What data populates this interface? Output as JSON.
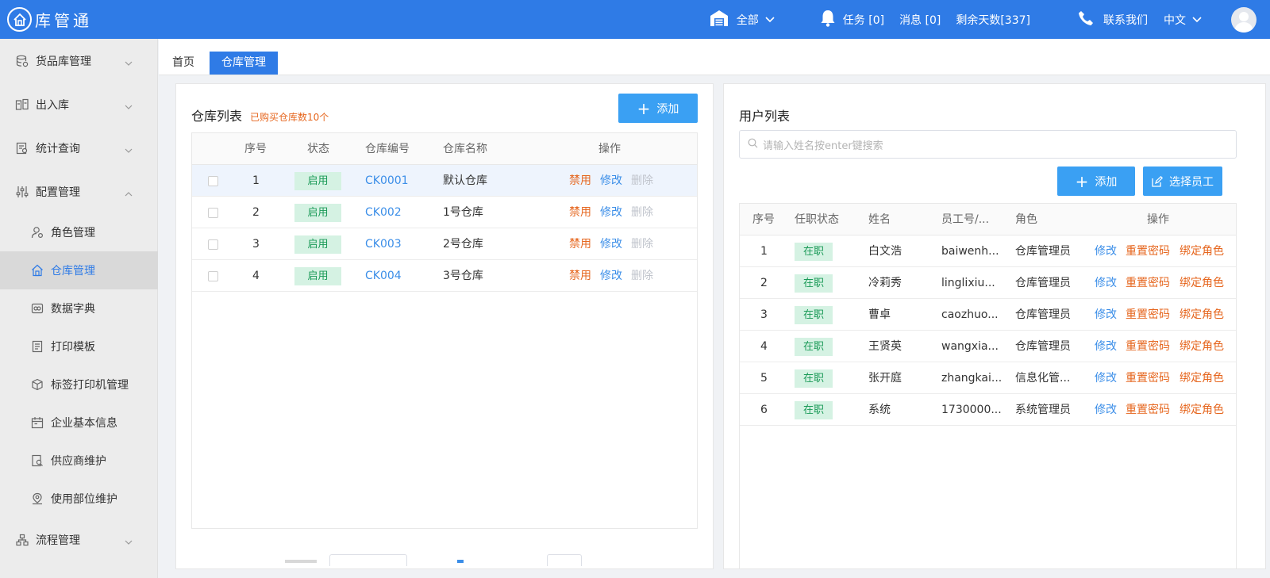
{
  "app": {
    "title": "库管通"
  },
  "topbar": {
    "warehouse_select": "全部",
    "tasks": "任务 [0]",
    "messages": "消息 [0]",
    "remaining_days": "剩余天数[337]",
    "contact": "联系我们",
    "language": "中文"
  },
  "sidebar": {
    "items": [
      {
        "label": "货品库管理"
      },
      {
        "label": "出入库"
      },
      {
        "label": "统计查询"
      },
      {
        "label": "配置管理"
      },
      {
        "label": "角色管理"
      },
      {
        "label": "仓库管理"
      },
      {
        "label": "数据字典"
      },
      {
        "label": "打印模板"
      },
      {
        "label": "标签打印机管理"
      },
      {
        "label": "企业基本信息"
      },
      {
        "label": "供应商维护"
      },
      {
        "label": "使用部位维护"
      },
      {
        "label": "流程管理"
      }
    ]
  },
  "tabs": [
    {
      "label": "首页"
    },
    {
      "label": "仓库管理"
    }
  ],
  "warehouse_panel": {
    "title": "仓库列表",
    "subtitle": "已购买仓库数10个",
    "add_label": "添加",
    "columns": [
      "序号",
      "状态",
      "仓库编号",
      "仓库名称",
      "操作"
    ],
    "actions": {
      "disable": "禁用",
      "edit": "修改",
      "delete": "删除"
    },
    "rows": [
      {
        "no": "1",
        "status": "启用",
        "code": "CK0001",
        "name": "默认仓库"
      },
      {
        "no": "2",
        "status": "启用",
        "code": "CK002",
        "name": "1号仓库"
      },
      {
        "no": "3",
        "status": "启用",
        "code": "CK003",
        "name": "2号仓库"
      },
      {
        "no": "4",
        "status": "启用",
        "code": "CK004",
        "name": "3号仓库"
      }
    ]
  },
  "user_panel": {
    "title": "用户列表",
    "search_placeholder": "请输入姓名按enter键搜索",
    "add_label": "添加",
    "select_label": "选择员工",
    "columns": [
      "序号",
      "任职状态",
      "姓名",
      "员工号/...",
      "角色",
      "操作"
    ],
    "actions": {
      "edit": "修改",
      "reset": "重置密码",
      "bind": "绑定角色"
    },
    "rows": [
      {
        "no": "1",
        "status": "在职",
        "name": "白文浩",
        "emp": "baiwenh...",
        "role": "仓库管理员"
      },
      {
        "no": "2",
        "status": "在职",
        "name": "冷莉秀",
        "emp": "linglixiu...",
        "role": "仓库管理员"
      },
      {
        "no": "3",
        "status": "在职",
        "name": "曹卓",
        "emp": "caozhuo...",
        "role": "仓库管理员"
      },
      {
        "no": "4",
        "status": "在职",
        "name": "王贤英",
        "emp": "wangxia...",
        "role": "仓库管理员"
      },
      {
        "no": "5",
        "status": "在职",
        "name": "张开庭",
        "emp": "zhangkai...",
        "role": "信息化管..."
      },
      {
        "no": "6",
        "status": "在职",
        "name": "系统",
        "emp": "1730000...",
        "role": "系统管理员"
      }
    ]
  },
  "colors": {
    "primary": "#2f7be6",
    "button": "#3aa0f3",
    "orange": "#e6661e",
    "green": "#1a9a57"
  }
}
